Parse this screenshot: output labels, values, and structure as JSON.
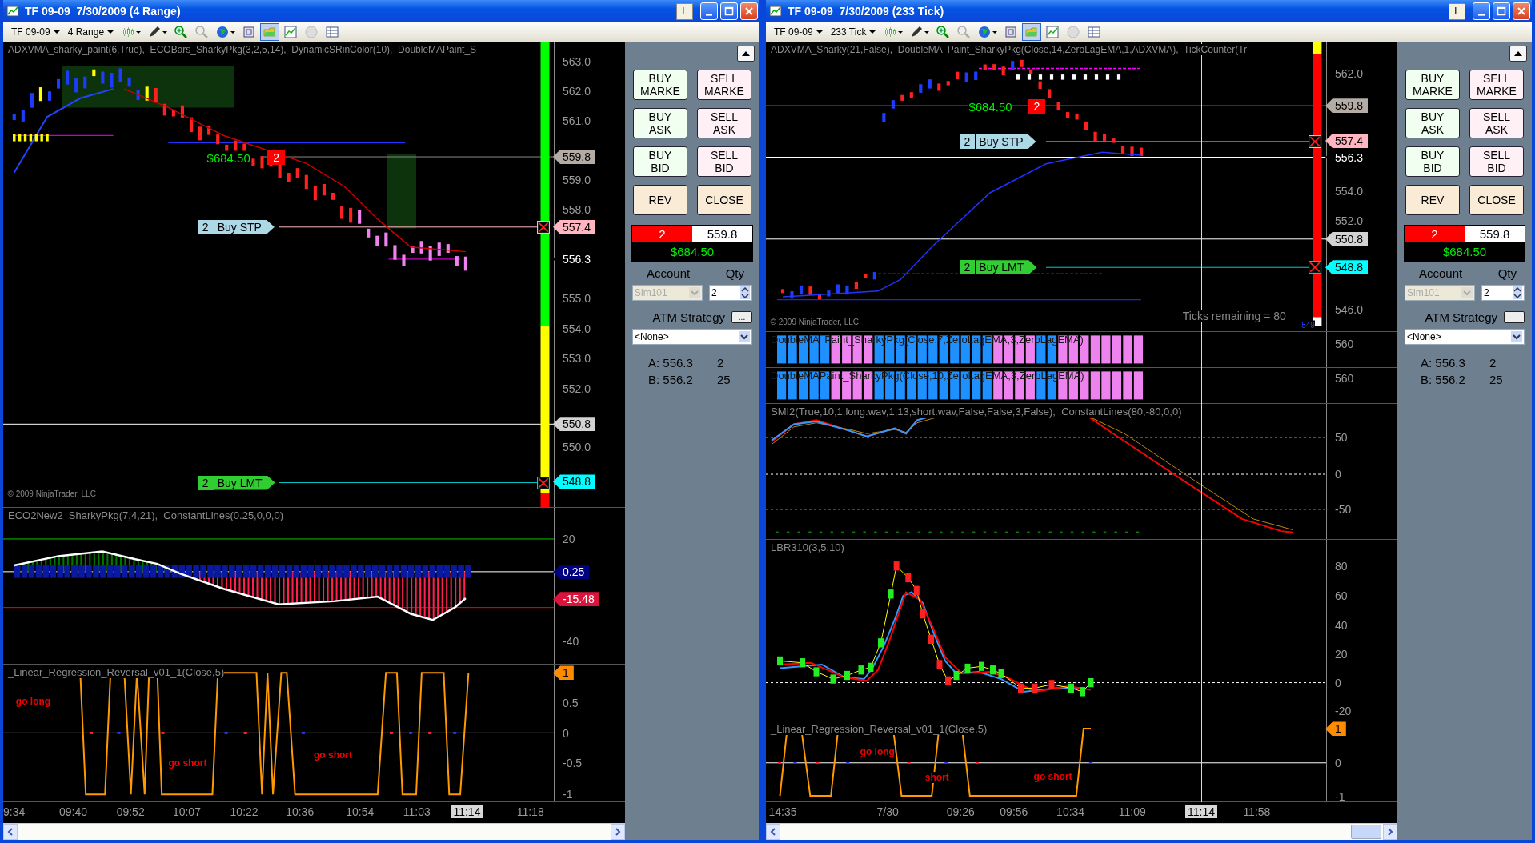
{
  "windows": [
    {
      "title": "TF 09-09  7/30/2009 (4 Range)",
      "title_button": "L",
      "toolbar": {
        "instrument": "TF 09-09",
        "period": "4 Range",
        "tools": [
          {
            "selected": false
          },
          {
            "selected": false
          },
          {
            "selected": false
          },
          {
            "selected": false
          },
          {
            "selected": false
          },
          {
            "selected": false
          },
          {
            "selected": true
          },
          {
            "selected": false
          },
          {
            "selected": false
          },
          {
            "selected": false
          }
        ]
      },
      "panels": [
        {
          "kind": "price",
          "title": "ADXVMA_sharky_paint(6,True),  ECOBars_SharkyPkg(3,2,5,14),  DynamicSRinColor(10),  DoubleMAPaint_S",
          "ticks": [
            "563.0",
            "562.0",
            "561.0",
            "559.0",
            "558.0",
            "555.0",
            "554.0",
            "553.0",
            "552.0",
            "550.0"
          ],
          "tags": [
            {
              "text": "559.8",
              "color": "#b4aca4"
            },
            {
              "text": "557.4",
              "color": "#ffb6c1"
            },
            {
              "text": "556.3",
              "color": "#000000"
            },
            {
              "text": "550.8",
              "color": "#d3d3d3"
            },
            {
              "text": "548.8",
              "color": "#00ffff"
            }
          ],
          "notes": [
            {
              "text": "$684.50",
              "kind": "pnl"
            },
            {
              "text": "2",
              "kind": "position"
            },
            {
              "text": "© 2009 NinjaTrader, LLC",
              "kind": "copyright"
            }
          ],
          "orders": [
            {
              "qty": "2",
              "type": "Buy STP",
              "kind": "stop"
            },
            {
              "qty": "2",
              "type": "Buy LMT",
              "kind": "limit"
            }
          ]
        },
        {
          "kind": "oscillator",
          "title": "ECO2New2_SharkyPkg(7,4,21),  ConstantLines(0.25,0,0,0)",
          "ticks": [
            "20",
            "-40"
          ],
          "tags": [
            {
              "text": "0.25",
              "color": "#000080"
            },
            {
              "text": "-15.48",
              "color": "#dc143c"
            }
          ]
        },
        {
          "kind": "reversal",
          "title": "_Linear_Regression_Reversal_v01_1(Close,5)",
          "ticks": [
            "0.5",
            "0",
            "-0.5",
            "-1"
          ],
          "tags": [
            {
              "text": "1",
              "color": "#ff8c00"
            }
          ],
          "notes": [
            {
              "text": "go long",
              "kind": "signal"
            },
            {
              "text": "go short",
              "kind": "signal"
            },
            {
              "text": "go short",
              "kind": "signal"
            }
          ]
        }
      ],
      "time_axis": [
        {
          "text": "9:34",
          "selected": false
        },
        {
          "text": "09:40",
          "selected": false
        },
        {
          "text": "09:52",
          "selected": false
        },
        {
          "text": "10:07",
          "selected": false
        },
        {
          "text": "10:22",
          "selected": false
        },
        {
          "text": "10:36",
          "selected": false
        },
        {
          "text": "10:54",
          "selected": false
        },
        {
          "text": "11:03",
          "selected": false
        },
        {
          "text": "11:14",
          "selected": true
        },
        {
          "text": "11:18",
          "selected": false
        }
      ],
      "side_panel": {
        "buttons": [
          {
            "text": "BUY MARKE",
            "kind": "buy"
          },
          {
            "text": "SELL MARKE",
            "kind": "sell"
          },
          {
            "text": "BUY ASK",
            "kind": "buy"
          },
          {
            "text": "SELL ASK",
            "kind": "sell"
          },
          {
            "text": "BUY BID",
            "kind": "buy"
          },
          {
            "text": "SELL BID",
            "kind": "sell"
          },
          {
            "text": "REV",
            "kind": "neutral"
          },
          {
            "text": "CLOSE",
            "kind": "neutral"
          }
        ],
        "position": {
          "qty": "2",
          "price": "559.8",
          "pnl": "$684.50"
        },
        "account_label": "Account",
        "account": "Sim101",
        "account_disabled": true,
        "qty_label": "Qty",
        "qty": "2",
        "atm_label": "ATM Strategy",
        "atm_button": "...",
        "atm_strategy": "<None>",
        "quotes": [
          {
            "price": "A: 556.3",
            "size": "2"
          },
          {
            "price": "B: 556.2",
            "size": "25"
          }
        ]
      }
    },
    {
      "title": "TF 09-09  7/30/2009 (233 Tick)",
      "title_button": "L",
      "toolbar": {
        "instrument": "TF 09-09",
        "period": "233 Tick",
        "tools": [
          {
            "selected": false
          },
          {
            "selected": false
          },
          {
            "selected": false
          },
          {
            "selected": false
          },
          {
            "selected": false
          },
          {
            "selected": false
          },
          {
            "selected": true
          },
          {
            "selected": false
          },
          {
            "selected": false
          },
          {
            "selected": false
          }
        ]
      },
      "panels": [
        {
          "kind": "price",
          "title": "ADXVMA_Sharky(21,False),  DoubleMA  Paint_SharkyPkg(Close,14,ZeroLagEMA,1,ADXVMA),  TickCounter(Tr",
          "ticks": [
            "562.0",
            "554.0",
            "552.0",
            "546.0"
          ],
          "tags": [
            {
              "text": "559.8",
              "color": "#b4aca4"
            },
            {
              "text": "557.4",
              "color": "#ffb6c1"
            },
            {
              "text": "556.3",
              "color": "#000000"
            },
            {
              "text": "550.8",
              "color": "#d3d3d3"
            },
            {
              "text": "548.8",
              "color": "#00ffff"
            }
          ],
          "notes": [
            {
              "text": "$684.50",
              "kind": "pnl"
            },
            {
              "text": "2",
              "kind": "position"
            },
            {
              "text": "© 2009 NinjaTrader, LLC",
              "kind": "copyright"
            },
            {
              "text": "Ticks remaining = 80",
              "kind": "info"
            },
            {
              "text": "549",
              "kind": "counter"
            }
          ],
          "orders": [
            {
              "qty": "2",
              "type": "Buy STP",
              "kind": "stop"
            },
            {
              "qty": "2",
              "type": "Buy LMT",
              "kind": "limit"
            }
          ]
        },
        {
          "kind": "paintbars",
          "title": "DoubleMA  Paint_SharkyPkg(Close,7,ZeroLagEMA,3,ZeroLagEMA)",
          "ticks": [
            "560"
          ]
        },
        {
          "kind": "paintbars",
          "title": "DoubleMAPaint_SharkyPkg(Close,10,ZeroLagEMA,3,ZeroLagEMA)",
          "ticks": [
            "560"
          ]
        },
        {
          "kind": "smi",
          "title": "SMI2(True,10,1,long.wav,1,13,short.wav,False,False,3,False),  ConstantLines(80,-80,0,0)",
          "ticks": [
            "50",
            "0",
            "-50"
          ]
        },
        {
          "kind": "lbr",
          "title": "LBR310(3,5,10)",
          "ticks": [
            "80",
            "60",
            "40",
            "20",
            "0",
            "-20"
          ]
        },
        {
          "kind": "reversal",
          "title": "_Linear_Regression_Reversal_v01_1(Close,5)",
          "ticks": [
            "0",
            "-1"
          ],
          "tags": [
            {
              "text": "1",
              "color": "#ff8c00"
            }
          ],
          "notes": [
            {
              "text": "go long",
              "kind": "signal"
            },
            {
              "text": "short",
              "kind": "signal"
            },
            {
              "text": "go short",
              "kind": "signal"
            }
          ]
        }
      ],
      "time_axis": [
        {
          "text": "14:35",
          "selected": false
        },
        {
          "text": "7/30",
          "selected": false
        },
        {
          "text": "09:26",
          "selected": false
        },
        {
          "text": "09:56",
          "selected": false
        },
        {
          "text": "10:34",
          "selected": false
        },
        {
          "text": "11:09",
          "selected": false
        },
        {
          "text": "11:14",
          "selected": true
        },
        {
          "text": "11:58",
          "selected": false
        }
      ],
      "side_panel": {
        "buttons": [
          {
            "text": "BUY MARKE",
            "kind": "buy"
          },
          {
            "text": "SELL MARKE",
            "kind": "sell"
          },
          {
            "text": "BUY ASK",
            "kind": "buy"
          },
          {
            "text": "SELL ASK",
            "kind": "sell"
          },
          {
            "text": "BUY BID",
            "kind": "buy"
          },
          {
            "text": "SELL BID",
            "kind": "sell"
          },
          {
            "text": "REV",
            "kind": "neutral"
          },
          {
            "text": "CLOSE",
            "kind": "neutral"
          }
        ],
        "position": {
          "qty": "2",
          "price": "559.8",
          "pnl": "$684.50"
        },
        "account_label": "Account",
        "account": "Sim101",
        "account_disabled": true,
        "qty_label": "Qty",
        "qty": "2",
        "atm_label": "ATM Strategy",
        "atm_strategy": "<None>",
        "quotes": [
          {
            "price": "A: 556.3",
            "size": "2"
          },
          {
            "price": "B: 556.2",
            "size": "25"
          }
        ]
      }
    }
  ]
}
